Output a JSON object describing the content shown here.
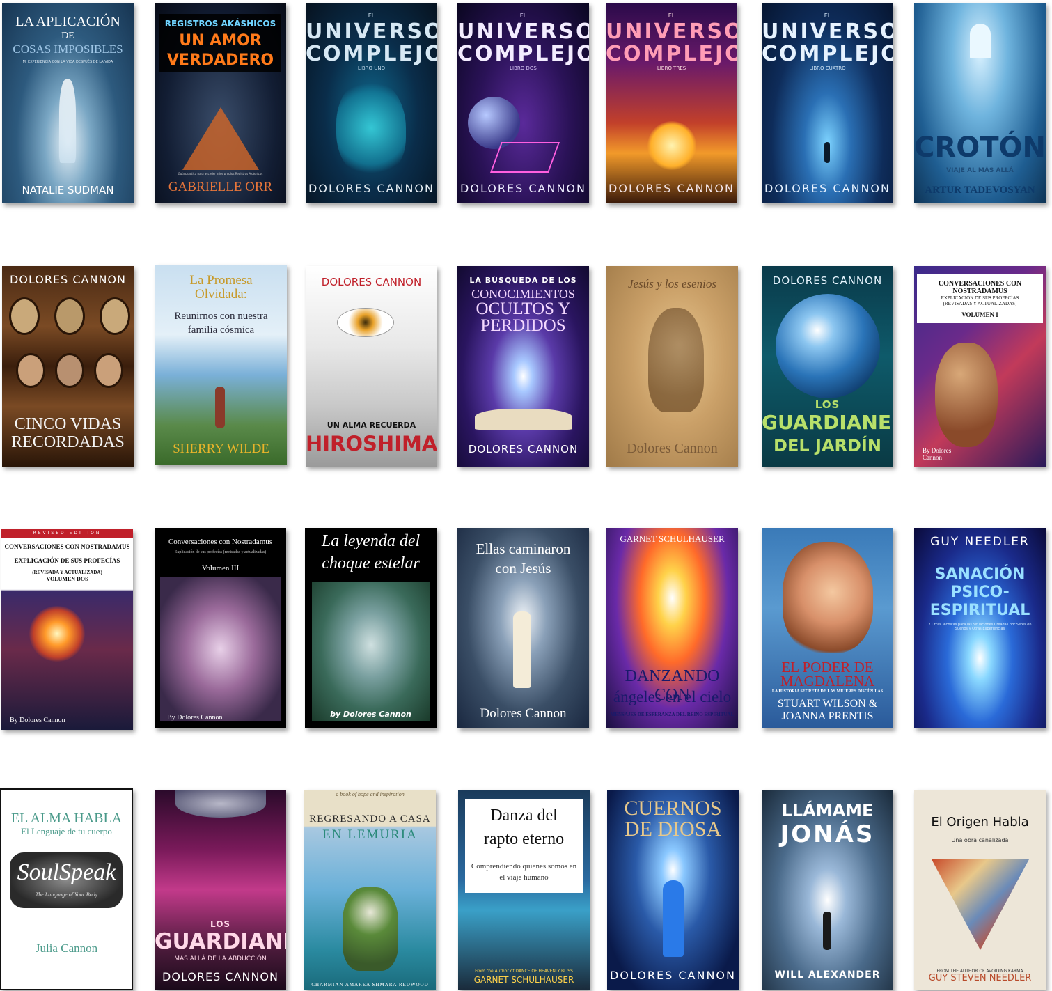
{
  "books": [
    {
      "id": "aplicacion",
      "lines": [
        "LA APLICACIÓN",
        "DE",
        "COSAS IMPOSIBLES"
      ],
      "sub": "MI EXPERIENCIA CON LA VIDA DESPUÉS DE LA VIDA",
      "author": "NATALIE SUDMAN"
    },
    {
      "id": "amor",
      "kicker": "REGISTROS AKÁSHICOS",
      "lines": [
        "UN AMOR",
        "VERDADERO"
      ],
      "sub": "Guía práctica para acceder a los propios Registros Akáshicos",
      "author": "GABRIELLE ORR"
    },
    {
      "id": "universo1",
      "pre": "EL",
      "lines": [
        "UNIVERSO",
        "COMPLEJO"
      ],
      "sub": "LIBRO UNO",
      "author": "DOLORES CANNON"
    },
    {
      "id": "universo2",
      "pre": "EL",
      "lines": [
        "UNIVERSO",
        "COMPLEJO"
      ],
      "sub": "LIBRO DOS",
      "author": "DOLORES CANNON"
    },
    {
      "id": "universo3",
      "pre": "EL",
      "lines": [
        "UNIVERSO",
        "COMPLEJO"
      ],
      "sub": "LIBRO TRES",
      "author": "DOLORES CANNON"
    },
    {
      "id": "universo4",
      "pre": "EL",
      "lines": [
        "UNIVERSO",
        "COMPLEJO"
      ],
      "sub": "LIBRO CUATRO",
      "author": "DOLORES CANNON"
    },
    {
      "id": "croton",
      "lines": [
        "CROTÓN"
      ],
      "sub": "VIAJE AL MÁS ALLÁ",
      "author": "ARTUR TADEVOSYAN"
    },
    {
      "id": "cinco",
      "author": "DOLORES CANNON",
      "lines": [
        "CINCO VIDAS",
        "RECORDADAS"
      ]
    },
    {
      "id": "promesa",
      "lines": [
        "La Promesa",
        "Olvidada:"
      ],
      "sub": "Reunirnos con nuestra familia cósmica",
      "author": "SHERRY WILDE"
    },
    {
      "id": "hiroshima",
      "author": "DOLORES CANNON",
      "kicker": "UN ALMA RECUERDA",
      "lines": [
        "HIROSHIMA"
      ]
    },
    {
      "id": "busqueda",
      "kicker": "LA BÚSQUEDA DE LOS",
      "lines": [
        "CONOCIMIENTOS",
        "OCULTOS Y",
        "PERDIDOS"
      ],
      "author": "DOLORES CANNON"
    },
    {
      "id": "esenios",
      "lines": [
        "Jesús y los esenios"
      ],
      "author": "Dolores Cannon"
    },
    {
      "id": "jardin",
      "author": "DOLORES CANNON",
      "lines": [
        "LOS",
        "GUARDIANES",
        "DEL JARDÍN"
      ]
    },
    {
      "id": "nostra1",
      "lines": [
        "CONVERSACIONES CON",
        "NOSTRADAMUS"
      ],
      "sub": "EXPLICACIÓN DE SUS PROFECÍAS (REVISADAS Y ACTUALIZADAS)",
      "vol": "VOLUMEN I",
      "author": "By Dolores Cannon"
    },
    {
      "id": "nostra2",
      "kicker": "REVISED EDITION",
      "lines": [
        "CONVERSACIONES CON NOSTRADAMUS"
      ],
      "sub": "EXPLICACIÓN DE SUS PROFECÍAS",
      "sub2": "(REVISADA Y ACTUALIZADA)",
      "vol": "VOLUMEN DOS",
      "author": "By Dolores Cannon"
    },
    {
      "id": "nostra3",
      "lines": [
        "Conversaciones con Nostradamus"
      ],
      "sub": "Explicación de sus profecías (revisadas y actualizadas)",
      "vol": "Volumen III",
      "author": "By Dolores Cannon"
    },
    {
      "id": "leyenda",
      "lines": [
        "La leyenda del",
        "choque estelar"
      ],
      "author": "by Dolores Cannon"
    },
    {
      "id": "ellas",
      "lines": [
        "Ellas caminaron",
        "con Jesús"
      ],
      "author": "Dolores Cannon"
    },
    {
      "id": "danzando",
      "author": "GARNET SCHULHAUSER",
      "lines": [
        "DANZANDO CON",
        "ángeles en el cielo"
      ],
      "sub": "MENSAJES DE ESPERANZA DEL REINO ESPIRITUAL"
    },
    {
      "id": "magdalena",
      "lines": [
        "EL PODER DE",
        "MAGDALENA"
      ],
      "sub": "LA HISTORIA SECRETA DE LAS MUJERES DISCÍPULAS",
      "author": "STUART WILSON &",
      "author2": "JOANNA PRENTIS"
    },
    {
      "id": "sanacion",
      "author": "GUY NEEDLER",
      "lines": [
        "SANACIÓN",
        "PSICO-",
        "ESPIRITUAL"
      ],
      "sub": "Y Otras Técnicas para las Situaciones Creadas por Seres en Sueños y Otras Experiencias"
    },
    {
      "id": "alma",
      "lines": [
        "EL ALMA HABLA"
      ],
      "sub": "El Lenguaje de tu cuerpo",
      "logo": "SoulSpeak",
      "logo_sub": "The Language of Your Body",
      "author": "Julia Cannon"
    },
    {
      "id": "guardianes",
      "lines": [
        "LOS",
        "GUARDIANES"
      ],
      "sub": "MÁS ALLÁ DE LA ABDUCCIÓN",
      "author": "DOLORES CANNON"
    },
    {
      "id": "lemuria",
      "kicker": "a book of hope and inspiration",
      "lines": [
        "REGRESANDO A CASA",
        "EN LEMURIA"
      ],
      "author": "CHARMIAN AMAREA SHMARA REDWOOD"
    },
    {
      "id": "danza",
      "lines": [
        "Danza del",
        "rapto eterno"
      ],
      "sub": "Comprendiendo quienes somos en el viaje humano",
      "kicker": "From the Author of DANCE OF HEAVENLY BLISS",
      "author": "GARNET SCHULHAUSER"
    },
    {
      "id": "cuernos",
      "lines": [
        "CUERNOS",
        "DE DIOSA"
      ],
      "author": "DOLORES CANNON"
    },
    {
      "id": "jonas",
      "lines": [
        "LLÁMAME",
        "JONÁS"
      ],
      "author": "WILL ALEXANDER"
    },
    {
      "id": "origen",
      "lines": [
        "El Origen Habla"
      ],
      "sub": "Una obra canalizada",
      "kicker": "FROM THE AUTHOR OF AVOIDING KARMA",
      "author": "GUY STEVEN NEEDLER"
    }
  ]
}
